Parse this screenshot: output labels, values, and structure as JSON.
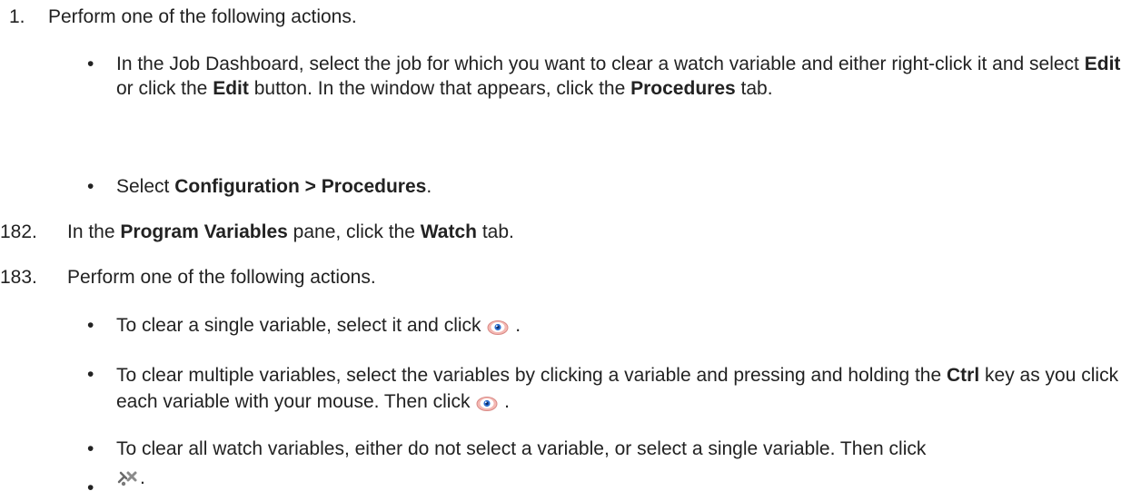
{
  "steps": [
    {
      "num": "1.",
      "text": "Perform one of the following actions."
    },
    {
      "num": "182.",
      "pre": "In the ",
      "b1": "Program Variables",
      "mid": " pane, click the ",
      "b2": "Watch",
      "post": " tab."
    },
    {
      "num": "183.",
      "text": "Perform one of the following actions."
    }
  ],
  "bullets1": [
    {
      "t1": "In the Job Dashboard, select the job for which you want to clear a watch variable and either right-click it and select ",
      "b1": "Edit",
      "t2": " or click the ",
      "b2": "Edit",
      "t3": " button. In the window that appears, click the ",
      "b3": "Procedures",
      "t4": " tab."
    },
    {
      "pre": "Select ",
      "bold": "Configuration > Procedures",
      "post": "."
    }
  ],
  "bullets2": [
    {
      "text": "To clear a single variable, select it and click",
      "icon": "eye-icon",
      "post": " ."
    },
    {
      "t1": "To clear multiple variables, select the variables by clicking a variable and pressing and holding the ",
      "b1": "Ctrl",
      "t2": " key as you click each variable with your mouse. Then click",
      "icon": "eye-icon",
      "post": " ."
    },
    {
      "text": "To clear all watch variables, either do not select a variable, or select a single variable. Then click"
    },
    {
      "icon": "clear-all-icon",
      "post": "."
    }
  ],
  "bullet_glyph": "•"
}
